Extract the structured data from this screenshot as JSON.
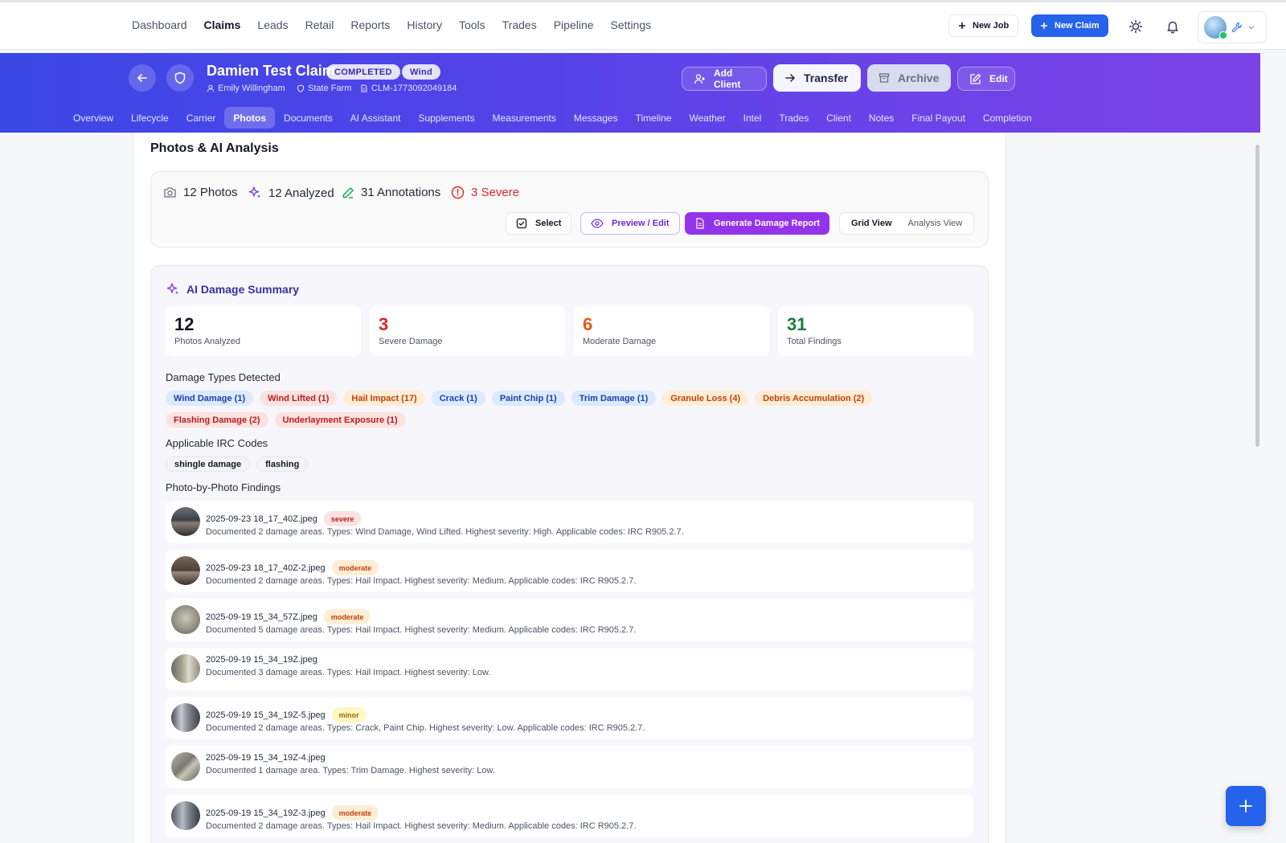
{
  "nav": {
    "links": [
      "Dashboard",
      "Claims",
      "Leads",
      "Retail",
      "Reports",
      "History",
      "Tools",
      "Trades",
      "Pipeline",
      "Settings"
    ],
    "active": "Claims",
    "new_job": "New Job",
    "new_claim": "New Claim"
  },
  "claim": {
    "title": "Damien Test Claim",
    "status": "COMPLETED",
    "type": "Wind",
    "client": "Emily Willingham",
    "carrier": "State Farm",
    "claim_number": "CLM-1773092049184"
  },
  "header_actions": {
    "add_client": "Add Client",
    "transfer": "Transfer",
    "archive": "Archive",
    "edit": "Edit"
  },
  "tabs": [
    "Overview",
    "Lifecycle",
    "Carrier",
    "Photos",
    "Documents",
    "AI Assistant",
    "Supplements",
    "Measurements",
    "Messages",
    "Timeline",
    "Weather",
    "Intel",
    "Trades",
    "Client",
    "Notes",
    "Final Payout",
    "Completion"
  ],
  "active_tab": "Photos",
  "page": {
    "title": "Photos & AI Analysis"
  },
  "stats": {
    "photos": "12 Photos",
    "analyzed": "12 Analyzed",
    "annotations": "31 Annotations",
    "severe": "3 Severe"
  },
  "toolbar": {
    "select": "Select",
    "preview_edit": "Preview / Edit",
    "generate_report": "Generate Damage Report",
    "grid_view": "Grid View",
    "analysis_view": "Analysis View"
  },
  "summary": {
    "title": "AI Damage Summary",
    "metrics": [
      {
        "value": "12",
        "label": "Photos Analyzed",
        "color": "#111827"
      },
      {
        "value": "3",
        "label": "Severe Damage",
        "color": "#dc2626"
      },
      {
        "value": "6",
        "label": "Moderate Damage",
        "color": "#ea580c"
      },
      {
        "value": "31",
        "label": "Total Findings",
        "color": "#15803d"
      }
    ],
    "damage_types_label": "Damage Types Detected",
    "damage_types_row1": [
      {
        "label": "Wind Damage (1)",
        "tone": "blue"
      },
      {
        "label": "Wind Lifted (1)",
        "tone": "red"
      },
      {
        "label": "Hail Impact (17)",
        "tone": "orange"
      },
      {
        "label": "Crack (1)",
        "tone": "blue"
      },
      {
        "label": "Paint Chip (1)",
        "tone": "blue"
      },
      {
        "label": "Trim Damage (1)",
        "tone": "blue"
      },
      {
        "label": "Granule Loss (4)",
        "tone": "orange"
      },
      {
        "label": "Debris Accumulation (2)",
        "tone": "orange"
      }
    ],
    "damage_types_row2": [
      {
        "label": "Flashing Damage (2)",
        "tone": "red"
      },
      {
        "label": "Underlayment Exposure (1)",
        "tone": "red"
      }
    ],
    "irc_label": "Applicable IRC Codes",
    "irc_codes": [
      "shingle damage",
      "flashing"
    ],
    "findings_label": "Photo-by-Photo Findings",
    "findings": [
      {
        "file": "2025-09-23 18_17_40Z.jpeg",
        "severity": "severe",
        "desc": "Documented 2 damage areas. Types: Wind Damage, Wind Lifted. Highest severity: High. Applicable codes: IRC R905.2.7."
      },
      {
        "file": "2025-09-23 18_17_40Z-2.jpeg",
        "severity": "moderate",
        "desc": "Documented 2 damage areas. Types: Hail Impact. Highest severity: Medium. Applicable codes: IRC R905.2.7."
      },
      {
        "file": "2025-09-19 15_34_57Z.jpeg",
        "severity": "moderate",
        "desc": "Documented 5 damage areas. Types: Hail Impact. Highest severity: Medium. Applicable codes: IRC R905.2.7."
      },
      {
        "file": "2025-09-19 15_34_19Z.jpeg",
        "severity": "",
        "desc": "Documented 3 damage areas. Types: Hail Impact. Highest severity: Low."
      },
      {
        "file": "2025-09-19 15_34_19Z-5.jpeg",
        "severity": "minor",
        "desc": "Documented 2 damage areas. Types: Crack, Paint Chip. Highest severity: Low. Applicable codes: IRC R905.2.7."
      },
      {
        "file": "2025-09-19 15_34_19Z-4.jpeg",
        "severity": "",
        "desc": "Documented 1 damage area. Types: Trim Damage. Highest severity: Low."
      },
      {
        "file": "2025-09-19 15_34_19Z-3.jpeg",
        "severity": "moderate",
        "desc": "Documented 2 damage areas. Types: Hail Impact. Highest severity: Medium. Applicable codes: IRC R905.2.7."
      }
    ]
  },
  "icons": {
    "plus": "plus-icon",
    "theme": "sun-icon",
    "notifications": "bell-icon",
    "fab": "plus-icon"
  }
}
